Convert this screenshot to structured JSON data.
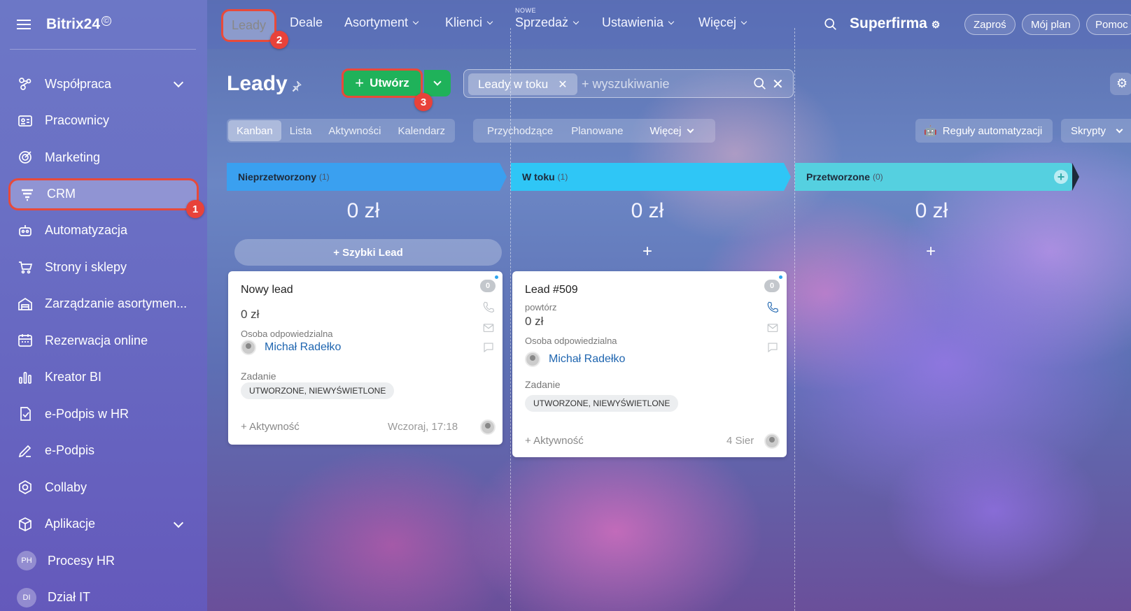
{
  "sidebar": {
    "brand": "Bitrix24",
    "brand_mark": "©",
    "items": [
      {
        "label": "Współpraca"
      },
      {
        "label": "Pracownicy"
      },
      {
        "label": "Marketing"
      },
      {
        "label": "CRM"
      },
      {
        "label": "Automatyzacja"
      },
      {
        "label": "Strony i sklepy"
      },
      {
        "label": "Zarządzanie asortymen..."
      },
      {
        "label": "Rezerwacja online"
      },
      {
        "label": "Kreator BI"
      },
      {
        "label": "e-Podpis w HR"
      },
      {
        "label": "e-Podpis"
      },
      {
        "label": "Collaby"
      },
      {
        "label": "Aplikacje"
      },
      {
        "label": "Procesy HR",
        "avatar": "PH"
      },
      {
        "label": "Dział IT",
        "avatar": "DI"
      }
    ]
  },
  "topnav": {
    "items": [
      "Leady",
      "Deale",
      "Asortyment",
      "Klienci",
      "Sprzedaż",
      "Ustawienia",
      "Więcej"
    ],
    "new_badge": "NOWE",
    "company": "Superfirma",
    "invite": "Zaproś",
    "plan": "Mój plan",
    "help": "Pomoc"
  },
  "badges": [
    "1",
    "2",
    "3"
  ],
  "page": {
    "title": "Leady",
    "create_label": "Utwórz",
    "filter_chip": "Leady w toku",
    "search_placeholder": "+ wyszukiwanie"
  },
  "view_tabs": [
    "Kanban",
    "Lista",
    "Aktywności",
    "Kalendarz"
  ],
  "filter_tabs": [
    "Przychodzące",
    "Planowane",
    "Więcej"
  ],
  "right_buttons": {
    "automation": "Reguły automatyzacji",
    "scripts": "Skrypty"
  },
  "columns": [
    {
      "name": "Nieprzetworzony",
      "count": "(1)",
      "sum": "0 zł",
      "color": "#3aa0f0"
    },
    {
      "name": "W toku",
      "count": "(1)",
      "sum": "0 zł",
      "color": "#2fc6f6"
    },
    {
      "name": "Przetworzone",
      "count": "(0)",
      "sum": "0 zł",
      "color": "#55d0e0"
    }
  ],
  "quick_lead": "+ Szybki Lead",
  "cards": [
    {
      "title": "Nowy lead",
      "amount": "0 zł",
      "resp_label": "Osoba odpowiedzialna",
      "user": "Michał Radełko",
      "task_label": "Zadanie",
      "tag": "UTWORZONE, NIEWYŚWIETLONE",
      "activity": "+ Aktywność",
      "date": "Wczoraj, 17:18",
      "count": "0"
    },
    {
      "title": "Lead #509",
      "subtitle": "powtórz",
      "amount": "0 zł",
      "resp_label": "Osoba odpowiedzialna",
      "user": "Michał Radełko",
      "task_label": "Zadanie",
      "tag": "UTWORZONE, NIEWYŚWIETLONE",
      "activity": "+ Aktywność",
      "date": "4 Sier",
      "count": "0"
    }
  ]
}
